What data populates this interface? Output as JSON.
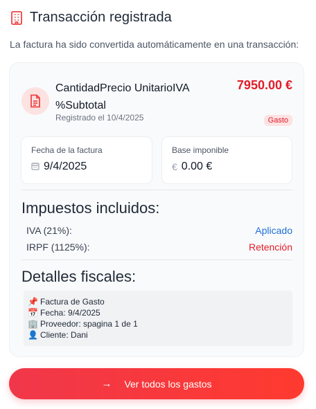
{
  "header": {
    "title": "Transacción registrada",
    "subtitle": "La factura ha sido convertida automáticamente en una transacción:",
    "icon": "building-icon"
  },
  "transaction": {
    "name": "CantidadPrecio UnitarioIVA %Subtotal",
    "registered": "Registrado el 10/4/2025",
    "amount": "7950.00 €",
    "type_badge": "Gasto",
    "icon": "document-icon"
  },
  "invoice_date": {
    "label": "Fecha de la factura",
    "value": "9/4/2025",
    "icon": "calendar-icon"
  },
  "taxable_base": {
    "label": "Base imponible",
    "value": "0.00 €",
    "icon": "euro-icon"
  },
  "taxes": {
    "title": "Impuestos incluidos:",
    "items": [
      {
        "label": "IVA (21%):",
        "status": "Aplicado"
      },
      {
        "label": "IRPF (1125%):",
        "status": "Retención"
      }
    ]
  },
  "fiscal": {
    "title": "Detalles fiscales:",
    "lines": [
      {
        "icon": "pushpin-icon",
        "text": "Factura de Gasto"
      },
      {
        "icon": "calendar-icon",
        "text": "Fecha: 9/4/2025"
      },
      {
        "icon": "office-building-icon",
        "text": "Proveedor: spagina 1 de 1"
      },
      {
        "icon": "user-icon",
        "text": "Cliente: Dani"
      }
    ]
  },
  "cta": {
    "label": "Ver todos los gastos",
    "icon": "arrow-right-icon"
  },
  "colors": {
    "accent": "#e11d2a",
    "link": "#1d6fd6",
    "badge_bg": "#fde2e2"
  }
}
